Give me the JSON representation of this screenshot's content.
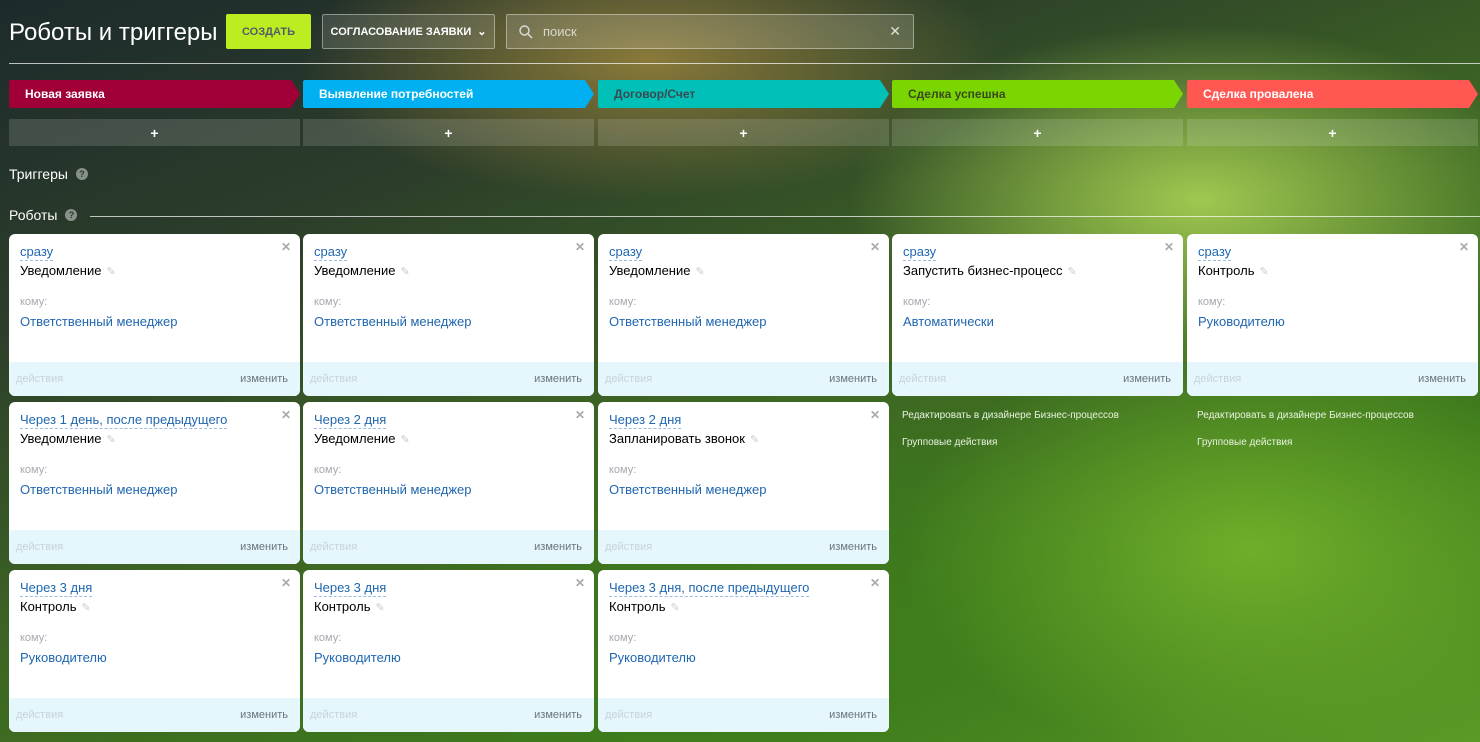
{
  "header": {
    "title": "Роботы и триггеры",
    "create_label": "СОЗДАТЬ",
    "category_label": "СОГЛАСОВАНИЕ ЗАЯВКИ",
    "search_placeholder": "поиск"
  },
  "stages": [
    {
      "label": "Новая заявка",
      "color": "#a00037",
      "text": "#ffffff"
    },
    {
      "label": "Выявление потребностей",
      "color": "#00b0f0",
      "text": "#ffffff"
    },
    {
      "label": "Договор/Счет",
      "color": "#00c0b8",
      "text": "#3a4a50"
    },
    {
      "label": "Сделка успешна",
      "color": "#7bd500",
      "text": "#3a4a20"
    },
    {
      "label": "Сделка провалена",
      "color": "#ff5752",
      "text": "#ffffff"
    }
  ],
  "plus_label": "+",
  "triggers_label": "Триггеры",
  "robots_label": "Роботы",
  "help_label": "?",
  "card_labels": {
    "to": "кому:",
    "actions": "действия",
    "edit": "изменить"
  },
  "columns": [
    [
      {
        "delay": "сразу",
        "name": "Уведомление",
        "to": "Ответственный менеджер"
      },
      {
        "delay": "Через 1 день, после предыдущего",
        "name": "Уведомление",
        "to": "Ответственный менеджер"
      },
      {
        "delay": "Через 3 дня",
        "name": "Контроль",
        "to": "Руководителю"
      }
    ],
    [
      {
        "delay": "сразу",
        "name": "Уведомление",
        "to": "Ответственный менеджер"
      },
      {
        "delay": "Через 2 дня",
        "name": "Уведомление",
        "to": "Ответственный менеджер"
      },
      {
        "delay": "Через 3 дня",
        "name": "Контроль",
        "to": "Руководителю"
      }
    ],
    [
      {
        "delay": "сразу",
        "name": "Уведомление",
        "to": "Ответственный менеджер"
      },
      {
        "delay": "Через 2 дня",
        "name": "Запланировать звонок",
        "to": "Ответственный менеджер"
      },
      {
        "delay": "Через 3 дня, после предыдущего",
        "name": "Контроль",
        "to": "Руководителю"
      }
    ],
    [
      {
        "delay": "сразу",
        "name": "Запустить бизнес-процесс",
        "to": "Автоматически"
      }
    ],
    [
      {
        "delay": "сразу",
        "name": "Контроль",
        "to": "Руководителю"
      }
    ]
  ],
  "links": {
    "designer": "Редактировать в дизайнере Бизнес-процессов",
    "group": "Групповые действия"
  }
}
